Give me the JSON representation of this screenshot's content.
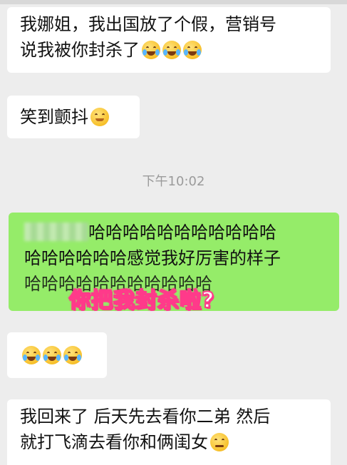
{
  "messages": [
    {
      "line1": "我娜姐，我出国放了个假，营销号",
      "line2": "说我被你封杀了"
    },
    {
      "text": "笑到颤抖"
    },
    {
      "line1": "哈哈哈哈哈哈哈哈哈哈哈",
      "line2": "哈哈哈哈哈哈感觉我好厉害的样子",
      "line3": "哈哈哈哈哈哈哈哈哈哈哈"
    },
    {
      "text": ""
    },
    {
      "line1": "我回来了 后天先去看你二弟 然后",
      "line2": "就打飞滴去看你和俩闺女"
    }
  ],
  "timestamp": "下午10:02",
  "overlay_caption": "你把我封杀啦?",
  "icons": [
    "crying-laughing-icon",
    "smile-icon",
    "thinking-icon"
  ]
}
